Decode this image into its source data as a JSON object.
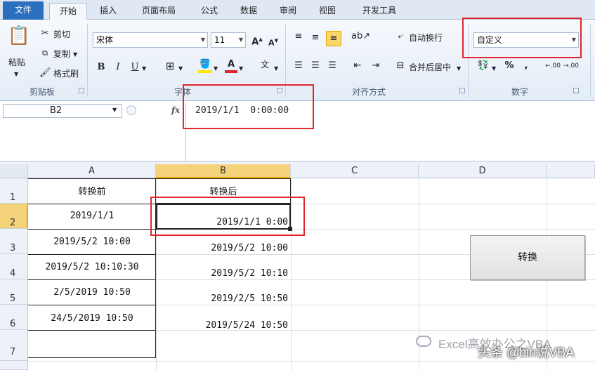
{
  "ribbon_tabs": [
    "文件",
    "开始",
    "插入",
    "页面布局",
    "公式",
    "数据",
    "审阅",
    "视图",
    "开发工具"
  ],
  "clipboard": {
    "paste": "粘贴",
    "cut": "剪切",
    "copy": "复制",
    "format_painter": "格式刷",
    "label": "剪贴板"
  },
  "font": {
    "name": "宋体",
    "size": "11",
    "label": "字体",
    "bold": "B",
    "italic": "I",
    "underline": "U"
  },
  "alignment": {
    "wrap": "自动换行",
    "merge": "合并后居中",
    "label": "对齐方式"
  },
  "number": {
    "format": "自定义",
    "label": "数字",
    "percent": "%",
    "comma": ",",
    "inc_decimal": ".00",
    "dec_decimal": ".00"
  },
  "name_box": "B2",
  "fx": "fx",
  "formula_value": "2019/1/1  0:00:00",
  "columns": [
    "A",
    "B",
    "C",
    "D"
  ],
  "rows": [
    "1",
    "2",
    "3",
    "4",
    "5",
    "6",
    "7"
  ],
  "col_a": [
    "转换前",
    "2019/1/1",
    "2019/5/2 10:00",
    "2019/5/2 10:10:30",
    "2/5/2019 10:50",
    "24/5/2019 10:50",
    ""
  ],
  "col_b": [
    "转换后",
    "2019/1/1 0:00",
    "2019/5/2 10:00",
    "2019/5/2 10:10",
    "2019/2/5 10:50",
    "2019/5/24 10:50",
    ""
  ],
  "convert_button": "转换",
  "watermark": "Excel高效办公之VBA",
  "watermark2": "头条 @bin说VBA",
  "colors": {
    "accent": "#2d6fbf",
    "highlight": "#e0262c",
    "selected_header": "#f5d37a"
  }
}
